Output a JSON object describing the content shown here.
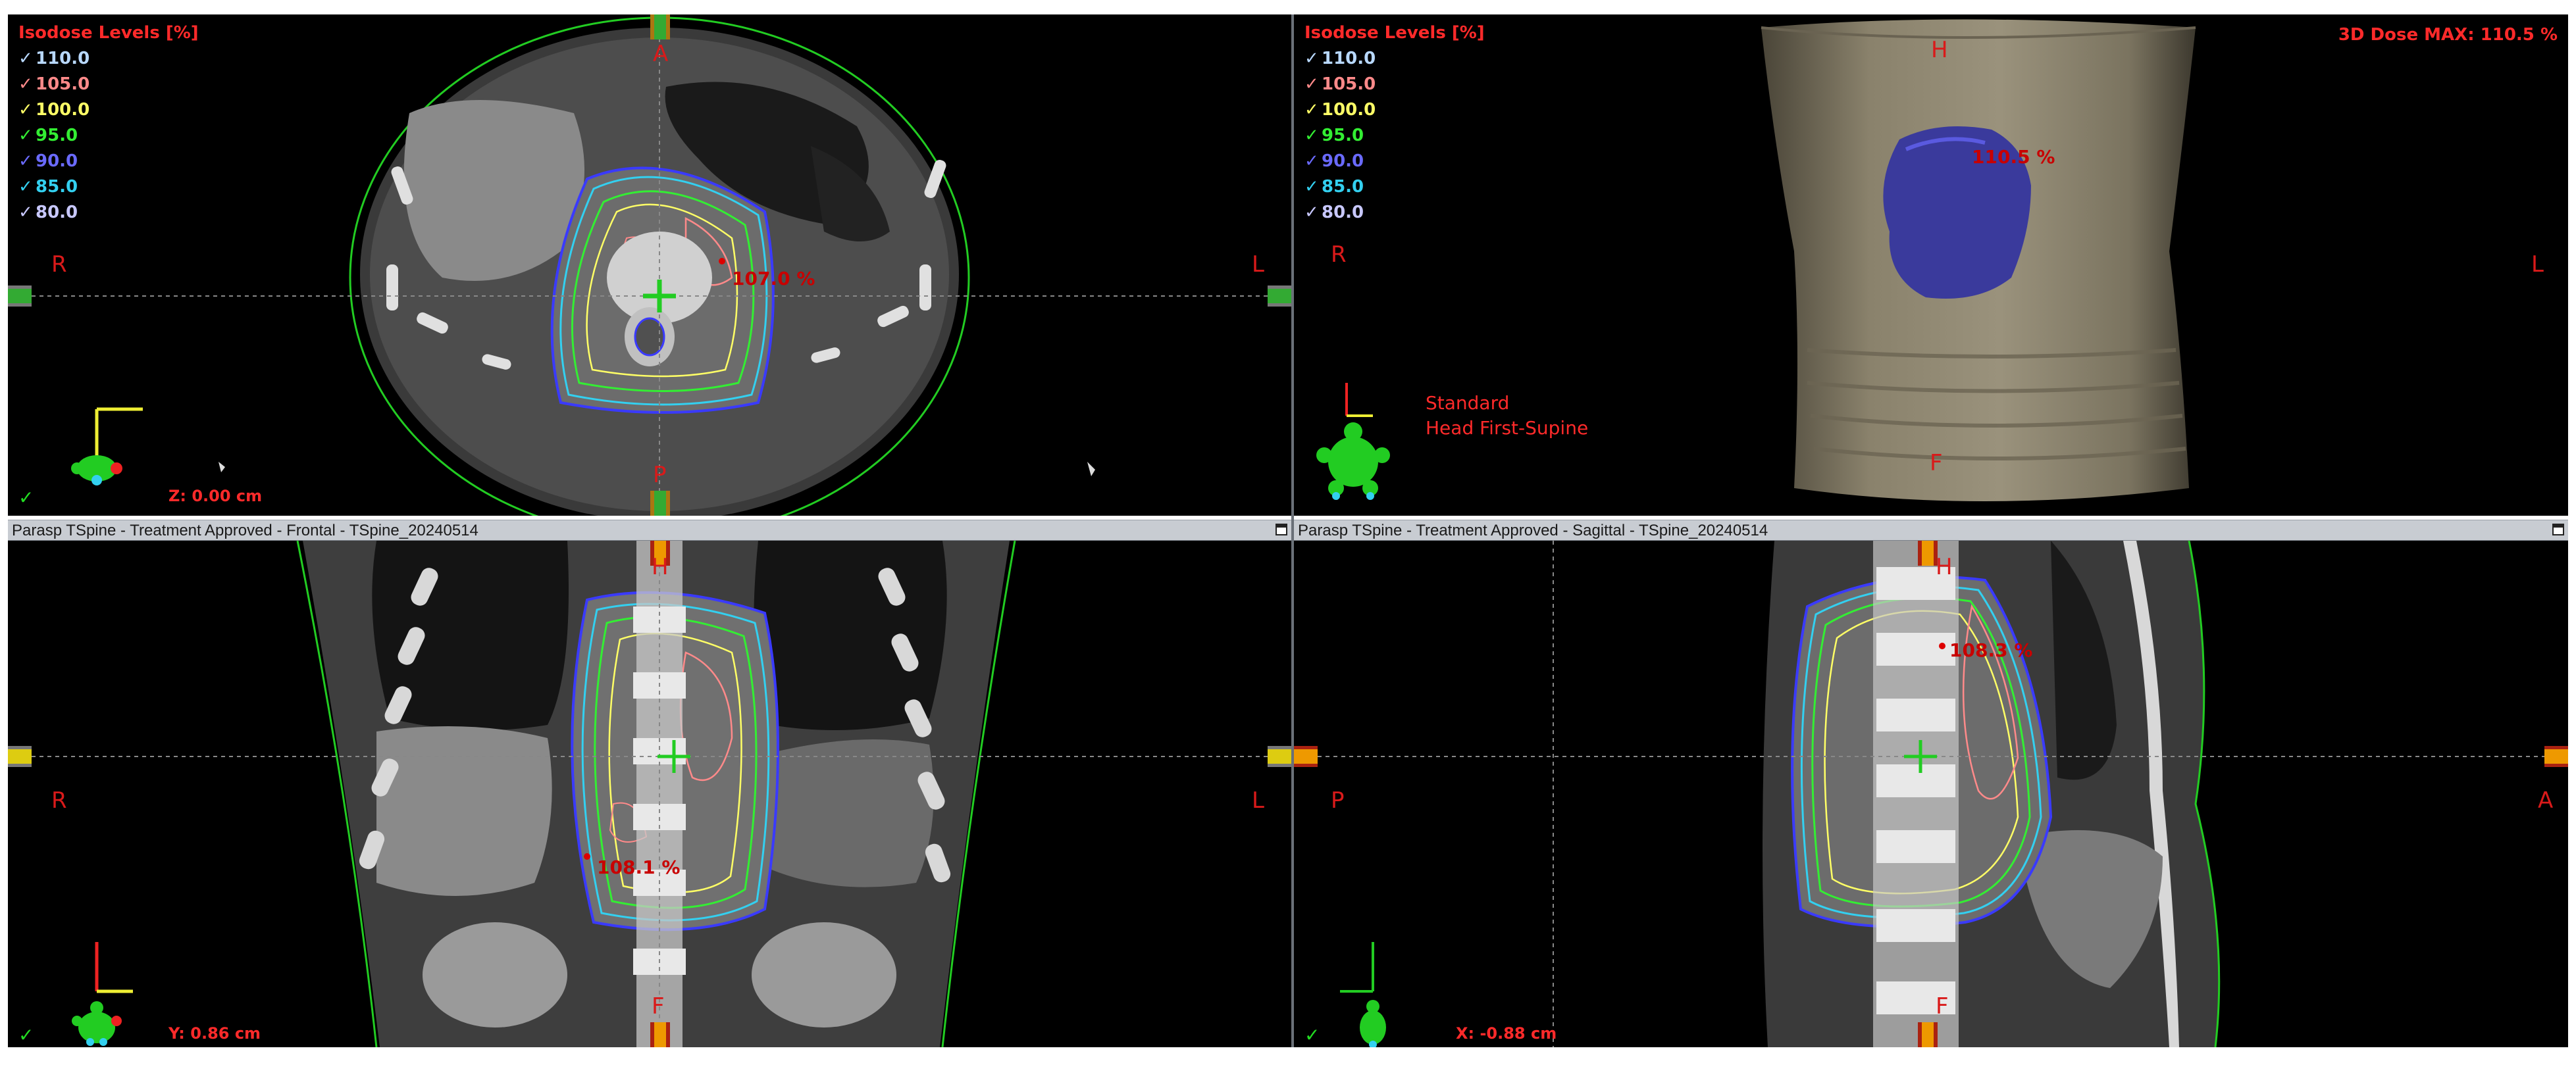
{
  "isodose": {
    "header": "Isodose Levels [%]",
    "levels": [
      {
        "value": "110.0",
        "color": "#b8d8ff"
      },
      {
        "value": "105.0",
        "color": "#ff8a8a"
      },
      {
        "value": "100.0",
        "color": "#ffff66"
      },
      {
        "value": "95.0",
        "color": "#33ee33"
      },
      {
        "value": "90.0",
        "color": "#6a6aff"
      },
      {
        "value": "85.0",
        "color": "#33d0f0"
      },
      {
        "value": "80.0",
        "color": "#c8c8ff"
      }
    ]
  },
  "axial": {
    "anterior": "A",
    "posterior": "P",
    "right": "R",
    "left": "L",
    "hotspot": "107.0 %",
    "coordinate": "Z: 0.00 cm",
    "status_check": "✓"
  },
  "view3d": {
    "head": "H",
    "foot": "F",
    "right": "R",
    "left": "L",
    "max_label": "3D Dose MAX: 110.5 %",
    "hotspot": "110.5 %",
    "orientation_line1": "Standard",
    "orientation_line2": "Head First-Supine"
  },
  "frontal": {
    "title": "Parasp TSpine  -  Treatment Approved - Frontal - TSpine_20240514",
    "head": "H",
    "foot": "F",
    "right": "R",
    "left": "L",
    "hotspot": "108.1 %",
    "coordinate": "Y: 0.86 cm",
    "status_check": "✓"
  },
  "sagittal": {
    "title": "Parasp TSpine  -  Treatment Approved - Sagittal - TSpine_20240514",
    "head": "H",
    "foot": "F",
    "posterior": "P",
    "anterior": "A",
    "hotspot": "108.3 %",
    "coordinate": "X: -0.88 cm",
    "status_check": "✓"
  }
}
